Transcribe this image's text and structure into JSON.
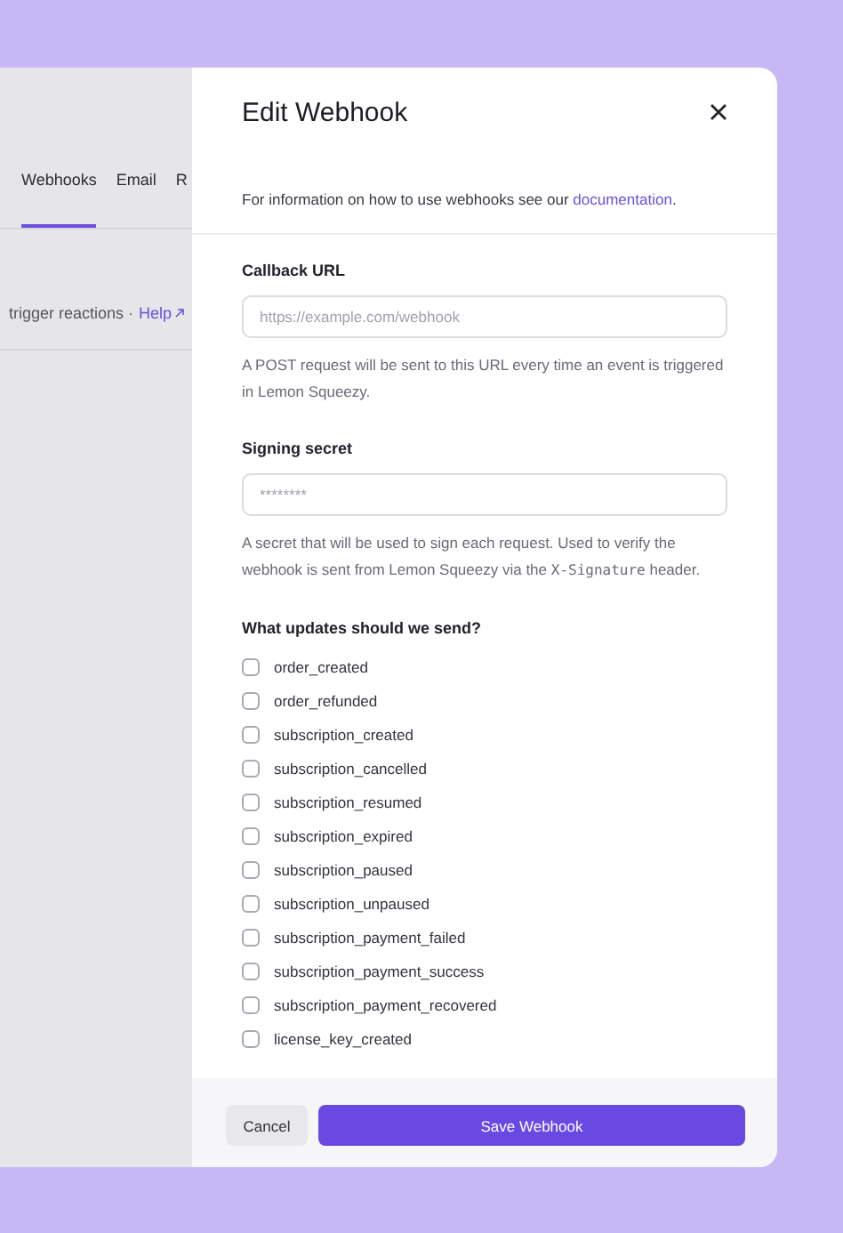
{
  "background_page": {
    "tabs": [
      {
        "label": "Webhooks",
        "selected": true
      },
      {
        "label": "Email",
        "selected": false
      },
      {
        "label": "R",
        "selected": false
      }
    ],
    "description": "trigger reactions ·",
    "help_link": "Help"
  },
  "dialog": {
    "title": "Edit Webhook",
    "intro": "For information on how to use webhooks see our",
    "intro_link": "documentation",
    "intro_end": ".",
    "callback_url": {
      "label": "Callback URL",
      "placeholder": "https://example.com/webhook",
      "help": "A POST request will be sent to this URL every time an event is triggered in Lemon Squeezy."
    },
    "signing_secret": {
      "label": "Signing secret",
      "placeholder": "********",
      "help": "A secret that will be used to sign each request. Used to verify the webhook is sent from Lemon Squeezy via the X-Signature header."
    },
    "events_label": "What updates should we send?",
    "events": [
      {
        "label": "order_created",
        "checked": false
      },
      {
        "label": "order_refunded",
        "checked": false
      },
      {
        "label": "subscription_created",
        "checked": false
      },
      {
        "label": "subscription_cancelled",
        "checked": false
      },
      {
        "label": "subscription_resumed",
        "checked": false
      },
      {
        "label": "subscription_expired",
        "checked": false
      },
      {
        "label": "subscription_paused",
        "checked": false
      },
      {
        "label": "subscription_unpaused",
        "checked": false
      },
      {
        "label": "subscription_payment_failed",
        "checked": false
      },
      {
        "label": "subscription_payment_success",
        "checked": false
      },
      {
        "label": "subscription_payment_recovered",
        "checked": false
      },
      {
        "label": "license_key_created",
        "checked": false
      }
    ],
    "buttons": {
      "cancel": "Cancel",
      "save": "Save Webhook"
    }
  }
}
